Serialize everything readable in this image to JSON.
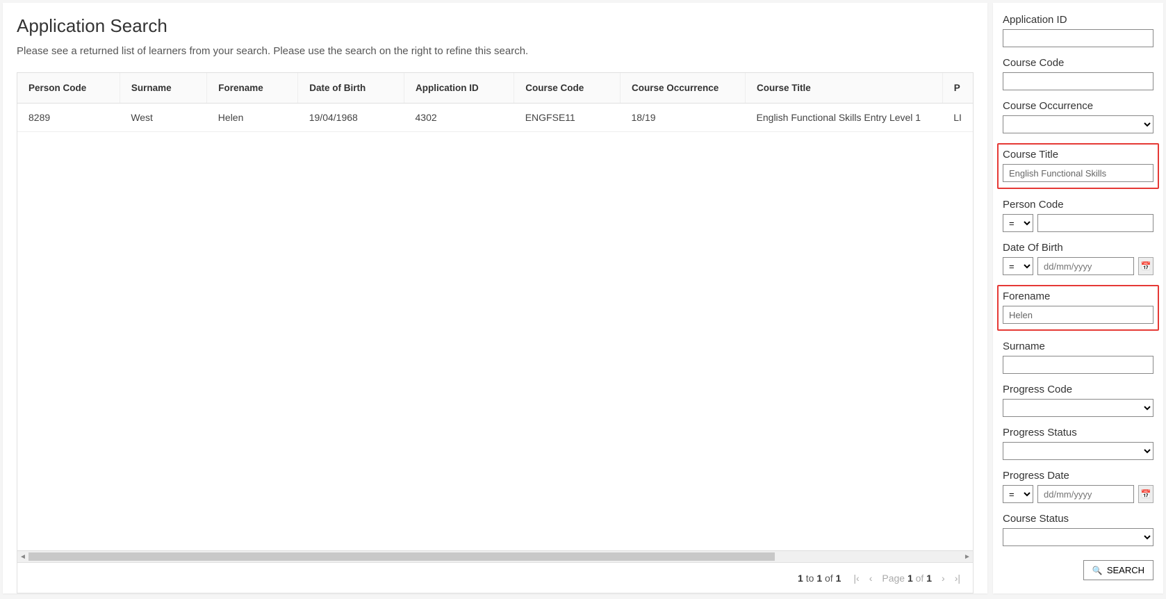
{
  "header": {
    "title": "Application Search",
    "subtitle": "Please see a returned list of learners from your search. Please use the search on the right to refine this search."
  },
  "table": {
    "columns": {
      "person_code": "Person Code",
      "surname": "Surname",
      "forename": "Forename",
      "dob": "Date of Birth",
      "application_id": "Application ID",
      "course_code": "Course Code",
      "course_occurrence": "Course Occurrence",
      "course_title": "Course Title",
      "extra": "P"
    },
    "row": {
      "person_code": "8289",
      "surname": "West",
      "forename": "Helen",
      "dob": "19/04/1968",
      "application_id": "4302",
      "course_code": "ENGFSE11",
      "course_occurrence": "18/19",
      "course_title": "English Functional Skills Entry Level 1",
      "extra": "LI"
    }
  },
  "pager": {
    "range_from": "1",
    "range_to_label": " to ",
    "range_to": "1",
    "range_of_label": " of ",
    "range_total": "1",
    "first_icon": "|‹",
    "prev_icon": "‹",
    "page_label": "Page ",
    "page_current": "1",
    "page_of_label": " of ",
    "page_total": "1",
    "next_icon": "›",
    "last_icon": "›|"
  },
  "filters": {
    "application_id": {
      "label": "Application ID",
      "value": ""
    },
    "course_code": {
      "label": "Course Code",
      "value": ""
    },
    "course_occurrence": {
      "label": "Course Occurrence",
      "selected": ""
    },
    "course_title": {
      "label": "Course Title",
      "value": "English Functional Skills"
    },
    "person_code": {
      "label": "Person Code",
      "op": "=",
      "value": ""
    },
    "dob": {
      "label": "Date Of Birth",
      "op": "=",
      "placeholder": "dd/mm/yyyy",
      "value": ""
    },
    "forename": {
      "label": "Forename",
      "value": "Helen"
    },
    "surname": {
      "label": "Surname",
      "value": ""
    },
    "progress_code": {
      "label": "Progress Code",
      "selected": ""
    },
    "progress_status": {
      "label": "Progress Status",
      "selected": ""
    },
    "progress_date": {
      "label": "Progress Date",
      "op": "=",
      "placeholder": "dd/mm/yyyy",
      "value": ""
    },
    "course_status": {
      "label": "Course Status",
      "selected": ""
    }
  },
  "search_button": "SEARCH"
}
